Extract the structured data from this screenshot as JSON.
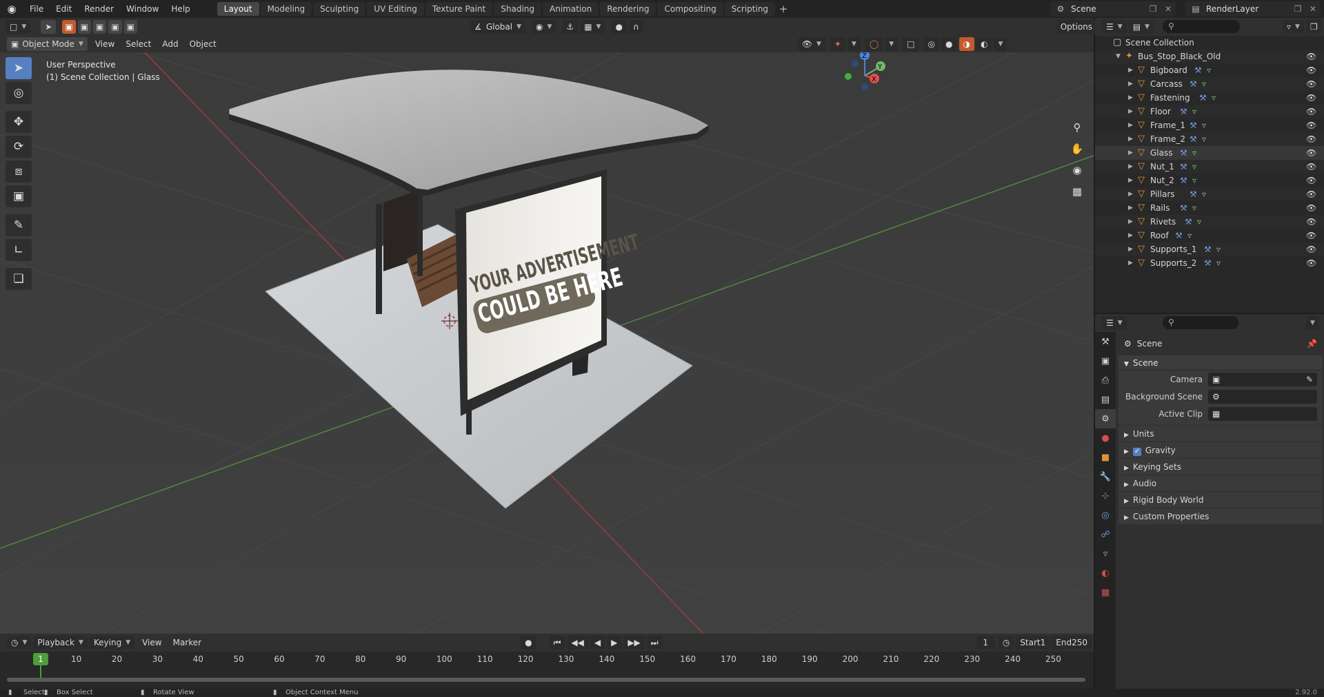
{
  "menu": [
    "File",
    "Edit",
    "Render",
    "Window",
    "Help"
  ],
  "workspaces": [
    "Layout",
    "Modeling",
    "Sculpting",
    "UV Editing",
    "Texture Paint",
    "Shading",
    "Animation",
    "Rendering",
    "Compositing",
    "Scripting"
  ],
  "active_workspace": "Layout",
  "scene_name": "Scene",
  "render_layer": "RenderLayer",
  "viewport": {
    "mode": "Object Mode",
    "menus": [
      "View",
      "Select",
      "Add",
      "Object"
    ],
    "transform_orientation": "Global",
    "options_label": "Options",
    "perspective_label": "User Perspective",
    "collection_label": "(1) Scene Collection | Glass"
  },
  "billboard": {
    "line1": "YOUR ADVERTISEMENT",
    "line2": "COULD BE HERE"
  },
  "gizmo": {
    "z": "Z",
    "y": "Y",
    "x": "X"
  },
  "outliner": {
    "root": "Scene Collection",
    "collection": "Bus_Stop_Black_Old",
    "objects": [
      "Bigboard",
      "Carcass",
      "Fastening",
      "Floor",
      "Frame_1",
      "Frame_2",
      "Glass",
      "Nut_1",
      "Nut_2",
      "Pillars",
      "Rails",
      "Rivets",
      "Roof",
      "Supports_1",
      "Supports_2"
    ],
    "selected": "Glass"
  },
  "properties": {
    "context": "Scene",
    "panel_title": "Scene",
    "fields": [
      {
        "label": "Camera",
        "value": ""
      },
      {
        "label": "Background Scene",
        "value": ""
      },
      {
        "label": "Active Clip",
        "value": ""
      }
    ],
    "subpanels": [
      "Units",
      "Gravity",
      "Keying Sets",
      "Audio",
      "Rigid Body World",
      "Custom Properties"
    ],
    "gravity_checked": true
  },
  "timeline": {
    "menus": [
      "Playback",
      "Keying",
      "View",
      "Marker"
    ],
    "current_frame": "1",
    "start_label": "Start",
    "start": "1",
    "end_label": "End",
    "end": "250",
    "ticks": [
      10,
      20,
      30,
      40,
      50,
      60,
      70,
      80,
      90,
      100,
      110,
      120,
      130,
      140,
      150,
      160,
      170,
      180,
      190,
      200,
      210,
      220,
      230,
      240,
      250
    ]
  },
  "statusbar": {
    "select": "Select",
    "box_select": "Box Select",
    "rotate_view": "Rotate View",
    "context_menu": "Object Context Menu",
    "version": "2.92.0"
  }
}
